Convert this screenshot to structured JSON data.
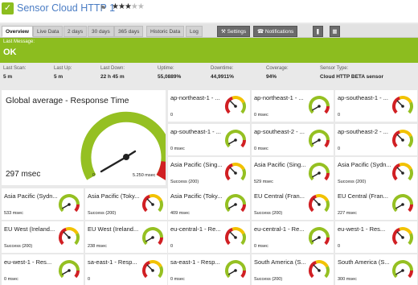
{
  "header": {
    "title": "Sensor Cloud HTTP 1",
    "priority_stars": 3,
    "priority_max": 5
  },
  "tabs": [
    "Overview",
    "Live Data",
    "2 days",
    "30 days",
    "365 days",
    "Historic Data",
    "Log"
  ],
  "toolbar": {
    "settings": "Settings",
    "notifications": "Notifications"
  },
  "status": {
    "label": "Last Message:",
    "value": "OK",
    "color": "#8cbd1f"
  },
  "stats": [
    {
      "k": "Last Scan:",
      "v": "5 m"
    },
    {
      "k": "Last Up:",
      "v": "5 m"
    },
    {
      "k": "Last Down:",
      "v": "22 h 45 m"
    },
    {
      "k": "Uptime:",
      "v": "55,0889%"
    },
    {
      "k": "Downtime:",
      "v": "44,9911%"
    },
    {
      "k": "Coverage:",
      "v": "94%"
    },
    {
      "k": "Sensor Type:",
      "v": "Cloud HTTP BETA sensor"
    }
  ],
  "global": {
    "name": "Global average - Response Time",
    "value": "297 msec",
    "min_label": "0",
    "max_label": "5.250 msec"
  },
  "gauges": [
    {
      "name": "ap-northeast-1 - ...",
      "value": "0",
      "kind": "r"
    },
    {
      "name": "ap-northeast-1 - ...",
      "value": "0 msec",
      "kind": "g"
    },
    {
      "name": "ap-southeast-1 - ...",
      "value": "0",
      "kind": "r"
    },
    {
      "name": "ap-southeast-1 - ...",
      "value": "0 msec",
      "kind": "g"
    },
    {
      "name": "ap-southeast-2 - ...",
      "value": "0 msec",
      "kind": "g"
    },
    {
      "name": "ap-southeast-2 - ...",
      "value": "0",
      "kind": "r"
    },
    {
      "name": "Asia Pacific (Sing...",
      "value": "Success (200)",
      "kind": "r"
    },
    {
      "name": "Asia Pacific (Sing...",
      "value": "529 msec",
      "kind": "g"
    },
    {
      "name": "Asia Pacific (Sydn...",
      "value": "Success (200)",
      "kind": "r"
    },
    {
      "name": "Asia Pacific (Sydn...",
      "value": "533 msec",
      "kind": "g"
    },
    {
      "name": "Asia Pacific (Toky...",
      "value": "Success (200)",
      "kind": "r"
    },
    {
      "name": "Asia Pacific (Toky...",
      "value": "409 msec",
      "kind": "g"
    },
    {
      "name": "EU Central (Fran...",
      "value": "Success (200)",
      "kind": "r"
    },
    {
      "name": "EU Central (Fran...",
      "value": "227 msec",
      "kind": "g"
    },
    {
      "name": "EU West (Ireland...",
      "value": "Success (200)",
      "kind": "r"
    },
    {
      "name": "EU West (Ireland...",
      "value": "238 msec",
      "kind": "g"
    },
    {
      "name": "eu-central-1 - Re...",
      "value": "0",
      "kind": "r"
    },
    {
      "name": "eu-central-1 - Re...",
      "value": "0 msec",
      "kind": "g"
    },
    {
      "name": "eu-west-1 - Res...",
      "value": "0",
      "kind": "r"
    },
    {
      "name": "eu-west-1 - Res...",
      "value": "0 msec",
      "kind": "g"
    },
    {
      "name": "sa-east-1 - Resp...",
      "value": "0",
      "kind": "r"
    },
    {
      "name": "sa-east-1 - Resp...",
      "value": "0 msec",
      "kind": "g"
    },
    {
      "name": "South America (S...",
      "value": "Success (200)",
      "kind": "r"
    },
    {
      "name": "South America (S...",
      "value": "300 msec",
      "kind": "g"
    }
  ]
}
